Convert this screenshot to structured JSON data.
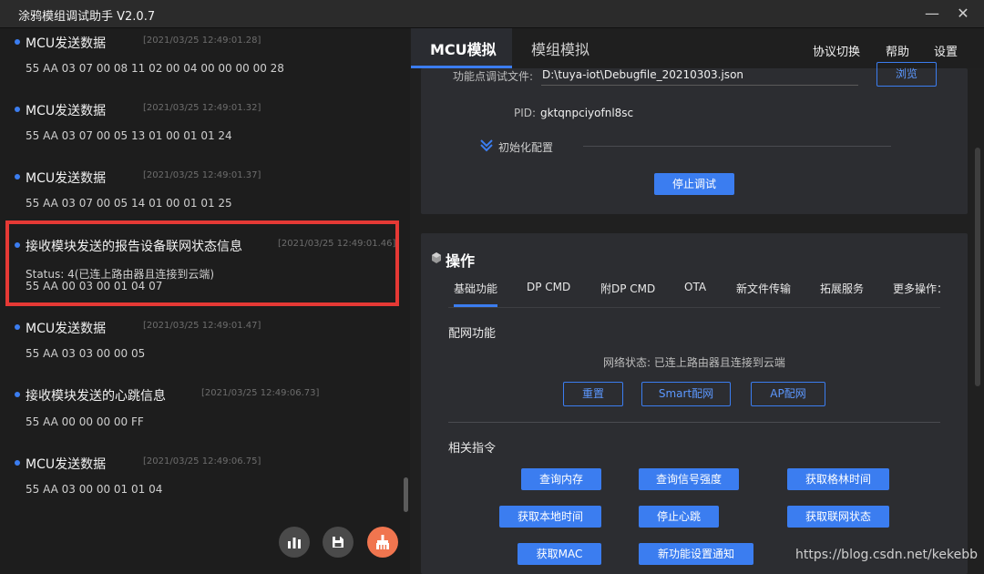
{
  "window": {
    "title": "涂鸦模组调试助手 V2.0.7",
    "minimize": "—",
    "close": "✕"
  },
  "log": [
    {
      "header": "MCU发送数据",
      "time": "[2021/03/25 12:49:01.28]",
      "lines": [
        "55 AA 03 07 00 08 11 02 00 04 00 00 00 00 28"
      ]
    },
    {
      "header": "MCU发送数据",
      "time": "[2021/03/25 12:49:01.32]",
      "lines": [
        "55 AA 03 07 00 05 13 01 00 01 01 24"
      ]
    },
    {
      "header": "MCU发送数据",
      "time": "[2021/03/25 12:49:01.37]",
      "lines": [
        "55 AA 03 07 00 05 14 01 00 01 01 25"
      ]
    },
    {
      "header": "接收模块发送的报告设备联网状态信息",
      "time": "[2021/03/25 12:49:01.46]",
      "lines": [
        "Status: 4(已连上路由器且连接到云端)",
        "55 AA 00 03 00 01 04 07"
      ]
    },
    {
      "header": "MCU发送数据",
      "time": "[2021/03/25 12:49:01.47]",
      "lines": [
        "55 AA 03 03 00 00 05"
      ]
    },
    {
      "header": "接收模块发送的心跳信息",
      "time": "[2021/03/25 12:49:06.73]",
      "lines": [
        "55 AA 00 00 00 00 FF"
      ]
    },
    {
      "header": "MCU发送数据",
      "time": "[2021/03/25 12:49:06.75]",
      "lines": [
        "55 AA 03 00 00 01 01 04"
      ]
    }
  ],
  "left_buttons": [
    {
      "icon": "chart-icon"
    },
    {
      "icon": "save-icon"
    },
    {
      "icon": "clear-icon"
    }
  ],
  "tabs": {
    "mcu": "MCU模拟",
    "module": "模组模拟"
  },
  "top_links": {
    "protocol": "协议切换",
    "help": "帮助",
    "settings": "设置"
  },
  "config": {
    "file_label": "功能点调试文件:",
    "file_value": "D:\\tuya-iot\\Debugfile_20210303.json",
    "browse": "浏览",
    "pid_label": "PID:",
    "pid_value": "gktqnpciyofnl8sc",
    "init_label": "初始化配置",
    "stop_debug": "停止调试"
  },
  "ops": {
    "title": "操作",
    "subtabs": [
      "基础功能",
      "DP CMD",
      "附DP CMD",
      "OTA",
      "新文件传输",
      "拓展服务",
      "更多操作："
    ],
    "network_title": "配网功能",
    "network_status": "网络状态: 已连上路由器且连接到云端",
    "network_buttons": [
      "重置",
      "Smart配网",
      "AP配网"
    ],
    "related_title": "相关指令",
    "commands": [
      "查询内存",
      "查询信号强度",
      "获取格林时间",
      "获取本地时间",
      "停止心跳",
      "获取联网状态",
      "获取MAC",
      "新功能设置通知"
    ]
  },
  "watermark": "https://blog.csdn.net/kekebb",
  "colors": {
    "accent": "#3b7df0",
    "highlight": "#e53935",
    "clear_button": "#f0754f"
  }
}
